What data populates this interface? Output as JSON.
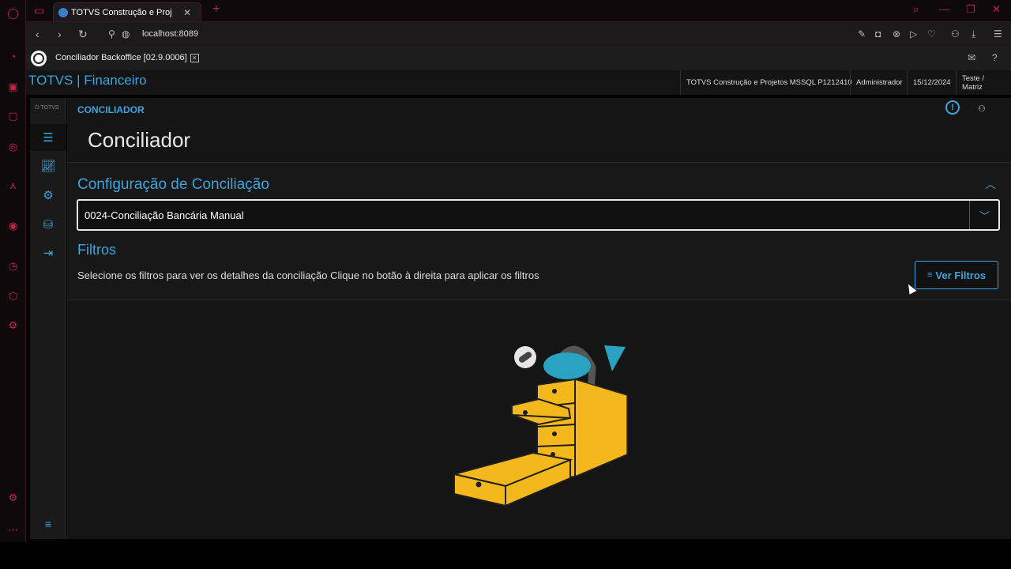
{
  "browser": {
    "tab_title": "TOTVS Construção e Projet",
    "tab_close": "✕",
    "new_tab": "+",
    "url": "localhost:8089"
  },
  "app": {
    "tab_label": "Conciliador Backoffice [02.9.0006]",
    "product_name": "TOTVS | Financeiro",
    "info": {
      "company": "TOTVS Construção e Projetos MSSQL P1212410",
      "user": "Administrador",
      "date": "15/12/2024",
      "branch": "Teste / Matriz"
    },
    "menu_logo": "TOTVS"
  },
  "page": {
    "breadcrumb": "CONCILIADOR",
    "title": "Conciliador",
    "config_title": "Configuração de Conciliação",
    "config_value": "0024-Conciliação Bancária Manual",
    "filters_title": "Filtros",
    "filters_desc": "Selecione os filtros para ver os detalhes da conciliação Clique no botão à direita para aplicar os filtros",
    "ver_filtros": "Ver Filtros"
  },
  "colors": {
    "accent": "#3da4dd",
    "opera_red": "#c0244a",
    "illustration_yellow": "#f3b81b"
  }
}
